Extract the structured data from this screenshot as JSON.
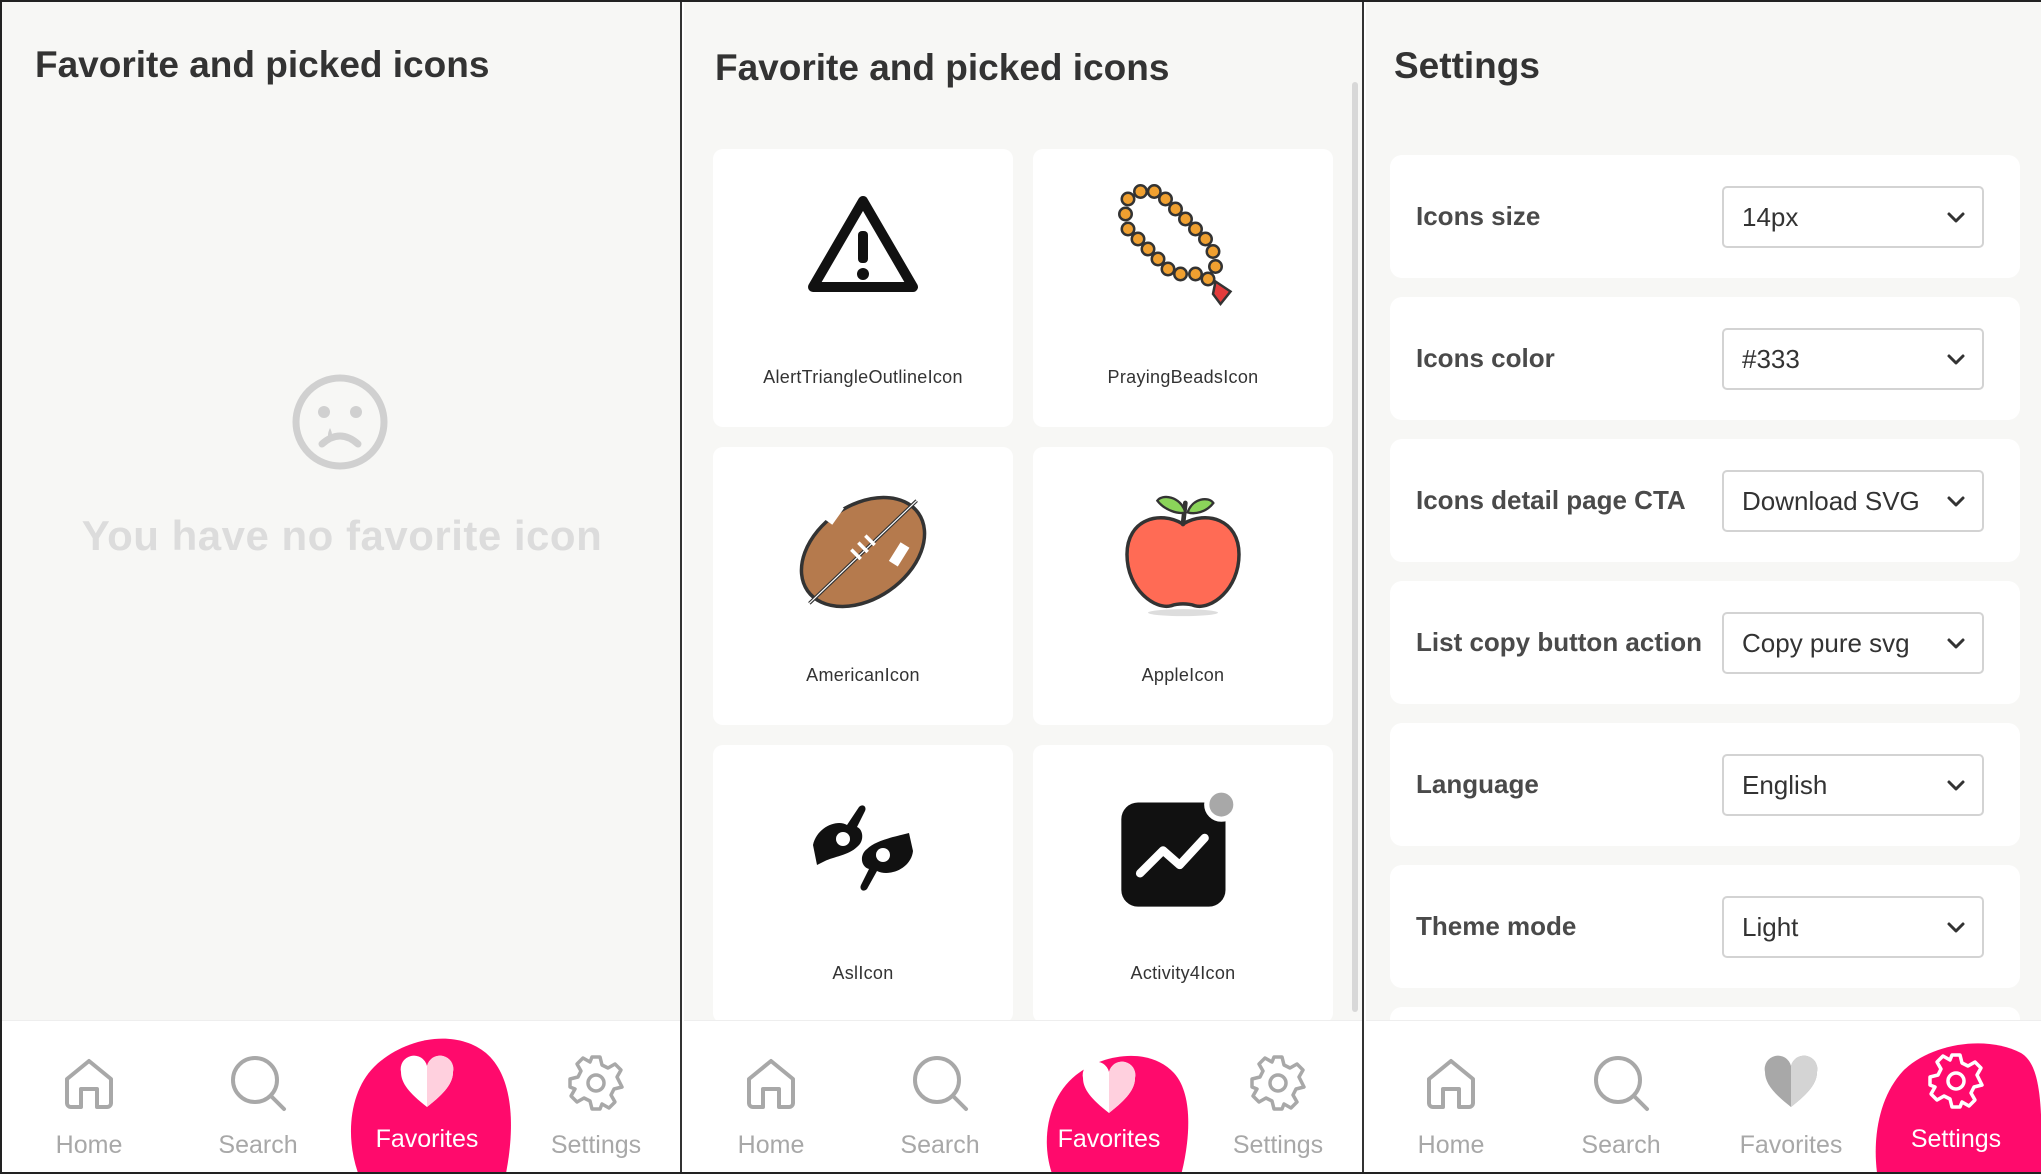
{
  "panels": {
    "favorites_empty": {
      "title_bold": "Favorite",
      "title_rest": " and picked icons",
      "empty_message": "You have no favorite icon",
      "face_icon": "sad-face-icon"
    },
    "favorites_list": {
      "title_bold": "Favorite",
      "title_rest": " and picked icons",
      "icons": [
        {
          "name": "AlertTriangleOutlineIcon",
          "icon": "alert-triangle-icon"
        },
        {
          "name": "PrayingBeadsIcon",
          "icon": "praying-beads-icon"
        },
        {
          "name": "AmericanIcon",
          "icon": "american-football-icon"
        },
        {
          "name": "AppleIcon",
          "icon": "apple-icon"
        },
        {
          "name": "AslIcon",
          "icon": "asl-hands-icon"
        },
        {
          "name": "Activity4Icon",
          "icon": "activity-icon"
        }
      ]
    },
    "settings": {
      "title": "Settings",
      "rows": [
        {
          "label": "Icons size",
          "value": "14px"
        },
        {
          "label": "Icons color",
          "value": "#333"
        },
        {
          "label": "Icons detail page CTA",
          "value": "Download SVG"
        },
        {
          "label": "List copy button action",
          "value": "Copy pure svg"
        },
        {
          "label": "Language",
          "value": "English"
        },
        {
          "label": "Theme mode",
          "value": "Light"
        }
      ]
    }
  },
  "nav": {
    "home": "Home",
    "search": "Search",
    "favorites": "Favorites",
    "settings": "Settings"
  },
  "colors": {
    "accent": "#ff0a6c",
    "muted": "#a8a8a8",
    "background": "#f7f7f5"
  }
}
